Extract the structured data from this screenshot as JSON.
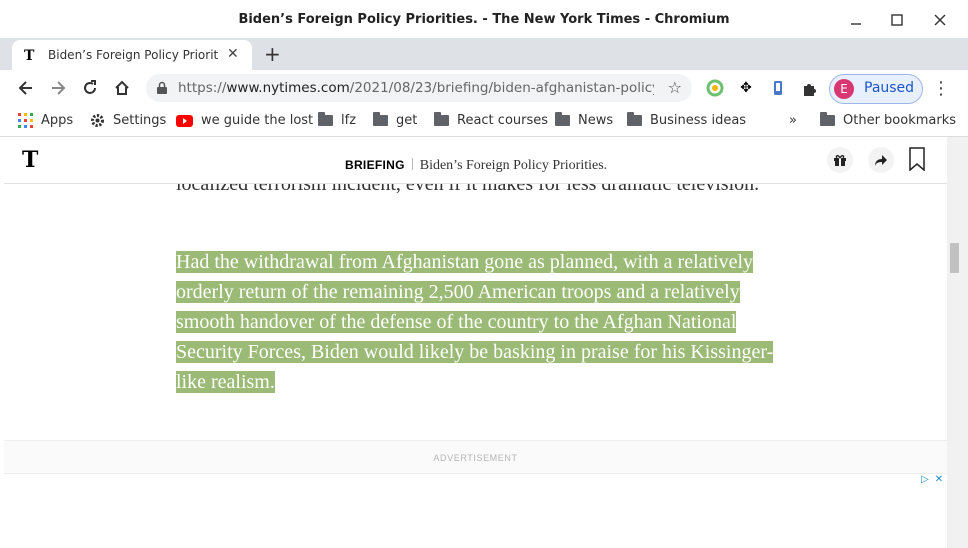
{
  "window": {
    "title": "Biden’s Foreign Policy Priorities. - The New York Times - Chromium"
  },
  "tab": {
    "label": "Biden’s Foreign Policy Priorities. - The New York Times",
    "favicon": "T"
  },
  "omnibox": {
    "scheme": "https://",
    "host": "www.nytimes.com",
    "path": "/2021/08/23/briefing/biden-afghanistan-policy...."
  },
  "profile": {
    "initial": "E",
    "status": "Paused"
  },
  "bookmarks": [
    {
      "label": "Apps",
      "icon": "apps-grid-icon"
    },
    {
      "label": "Settings",
      "icon": "gear-icon"
    },
    {
      "label": "we guide the lost",
      "icon": "youtube-icon"
    },
    {
      "label": "lfz",
      "icon": "folder-icon"
    },
    {
      "label": "get",
      "icon": "folder-icon"
    },
    {
      "label": "React courses",
      "icon": "folder-icon"
    },
    {
      "label": "News",
      "icon": "folder-icon"
    },
    {
      "label": "Business ideas",
      "icon": "folder-icon"
    }
  ],
  "other_bookmarks": "Other bookmarks",
  "nyt": {
    "logo": "T",
    "section": "BRIEFING",
    "headline": "Biden’s Foreign Policy Priorities."
  },
  "article": {
    "para_top": "localized terrorism incident, even if it makes for less dramatic television.",
    "para_selected": "Had the withdrawal from Afghanistan gone as planned, with a relatively orderly return of the remaining 2,500 American troops and a relatively smooth handover of the defense of the country to the Afghan National Security Forces, Biden would likely be basking in praise for his Kissinger-like realism."
  },
  "ad": {
    "label": "ADVERTISEMENT"
  },
  "colors": {
    "selection": "#9bba76",
    "profile_accent": "#d93772"
  }
}
